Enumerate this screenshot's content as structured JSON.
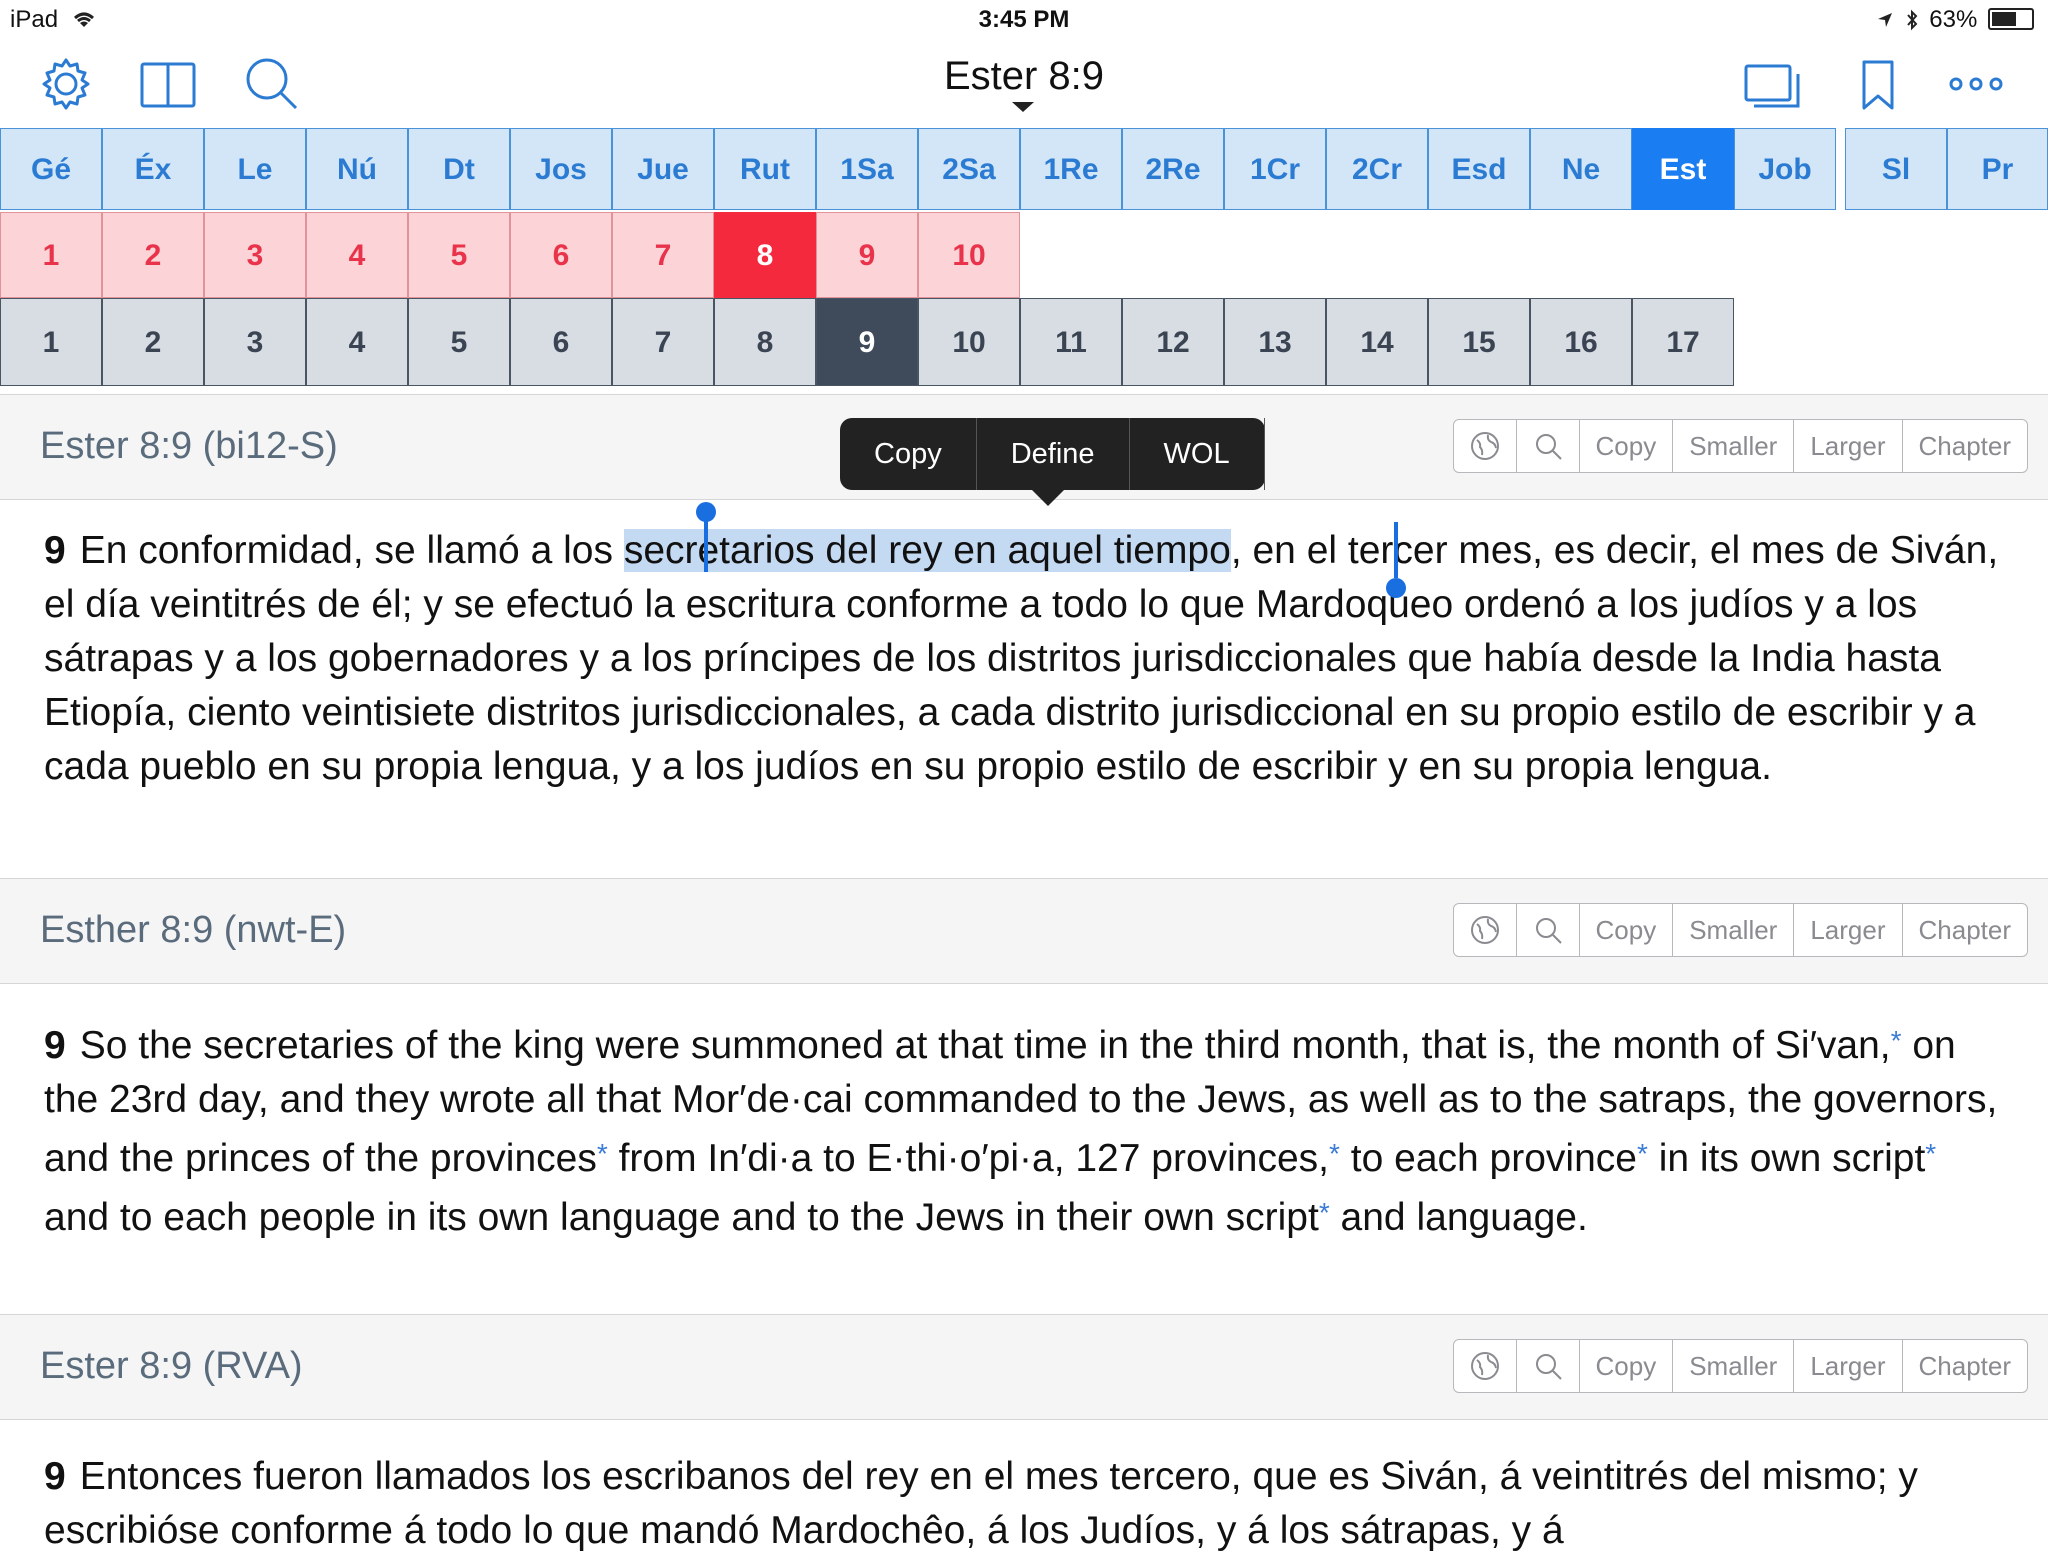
{
  "status": {
    "device": "iPad",
    "time": "3:45 PM",
    "battery": "63%"
  },
  "nav": {
    "title": "Ester 8:9"
  },
  "books": [
    {
      "label": "Gé"
    },
    {
      "label": "Éx"
    },
    {
      "label": "Le"
    },
    {
      "label": "Nú"
    },
    {
      "label": "Dt"
    },
    {
      "label": "Jos"
    },
    {
      "label": "Jue"
    },
    {
      "label": "Rut"
    },
    {
      "label": "1Sa"
    },
    {
      "label": "2Sa"
    },
    {
      "label": "1Re"
    },
    {
      "label": "2Re"
    },
    {
      "label": "1Cr"
    },
    {
      "label": "2Cr"
    },
    {
      "label": "Esd"
    },
    {
      "label": "Ne"
    },
    {
      "label": "Est",
      "selected": true
    },
    {
      "label": "Job"
    },
    {
      "label": "Sl"
    },
    {
      "label": "Pr"
    }
  ],
  "chapters": [
    "1",
    "2",
    "3",
    "4",
    "5",
    "6",
    "7",
    "8",
    "9",
    "10"
  ],
  "selected_chapter": "8",
  "verses": [
    "1",
    "2",
    "3",
    "4",
    "5",
    "6",
    "7",
    "8",
    "9",
    "10",
    "11",
    "12",
    "13",
    "14",
    "15",
    "16",
    "17"
  ],
  "selected_verse": "9",
  "toolbar": {
    "copy": "Copy",
    "smaller": "Smaller",
    "larger": "Larger",
    "chapter": "Chapter"
  },
  "popup": {
    "copy": "Copy",
    "define": "Define",
    "wol": "WOL"
  },
  "sections": [
    {
      "title": "Ester 8:9 (bi12-S)",
      "verse_num": "9",
      "text_before": "En conformidad, se llamó a los ",
      "text_selected": "secretarios del rey en aquel tiempo",
      "text_after": ", en el tercer mes, es decir, el mes de Siván, el día veintitrés de él; y se efectuó la escritura conforme a todo lo que Mardoqueo ordenó a los judíos y a los sátrapas y a los gobernadores y a los príncipes de los distritos jurisdiccionales que había desde la India hasta Etiopía, ciento veintisiete distritos jurisdiccionales, a cada distrito jurisdiccional en su propio estilo de escribir y a cada pueblo en su propia lengua, y a los judíos en su propio estilo de escribir y en su propia lengua."
    },
    {
      "title": "Esther 8:9 (nwt-E)",
      "verse_num": "9",
      "parts": [
        "So the secretaries of the king were summoned at that time in the third month, that is, the month of Si′van,",
        " on the 23rd day, and they wrote all that Mor′de·cai commanded to the Jews, as well as to the satraps, the governors, and the princes of the provinces",
        " from In′di·a to E·thi·o′pi·a, 127 provinces,",
        " to each province",
        " in its own script",
        " and to each people in its own language and to the Jews in their own script",
        " and language."
      ],
      "footnote_mark": "*"
    },
    {
      "title": "Ester 8:9 (RVA)",
      "verse_num": "9",
      "text": "Entonces fueron llamados los escribanos del rey en el mes tercero, que es Siván, á veintitrés del mismo; y escribióse conforme á todo lo que mandó Mardochêo, á los Judíos, y á los sátrapas, y á"
    }
  ]
}
